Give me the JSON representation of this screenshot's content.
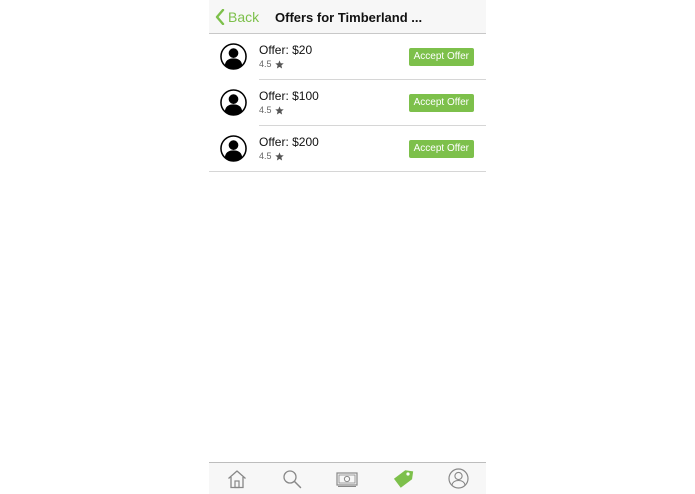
{
  "navbar": {
    "back_label": "Back",
    "title": "Offers for Timberland ..."
  },
  "offers": [
    {
      "amount": "Offer: $20",
      "rating": "4.5",
      "button": "Accept Offer"
    },
    {
      "amount": "Offer: $100",
      "rating": "4.5",
      "button": "Accept Offer"
    },
    {
      "amount": "Offer: $200",
      "rating": "4.5",
      "button": "Accept Offer"
    }
  ],
  "tabbar": {
    "items": [
      {
        "icon": "home-icon",
        "active": false
      },
      {
        "icon": "search-icon",
        "active": false
      },
      {
        "icon": "money-icon",
        "active": false
      },
      {
        "icon": "tag-icon",
        "active": true
      },
      {
        "icon": "profile-icon",
        "active": false
      }
    ]
  },
  "colors": {
    "accent": "#7dc04b",
    "inactive_icon": "#888888"
  }
}
